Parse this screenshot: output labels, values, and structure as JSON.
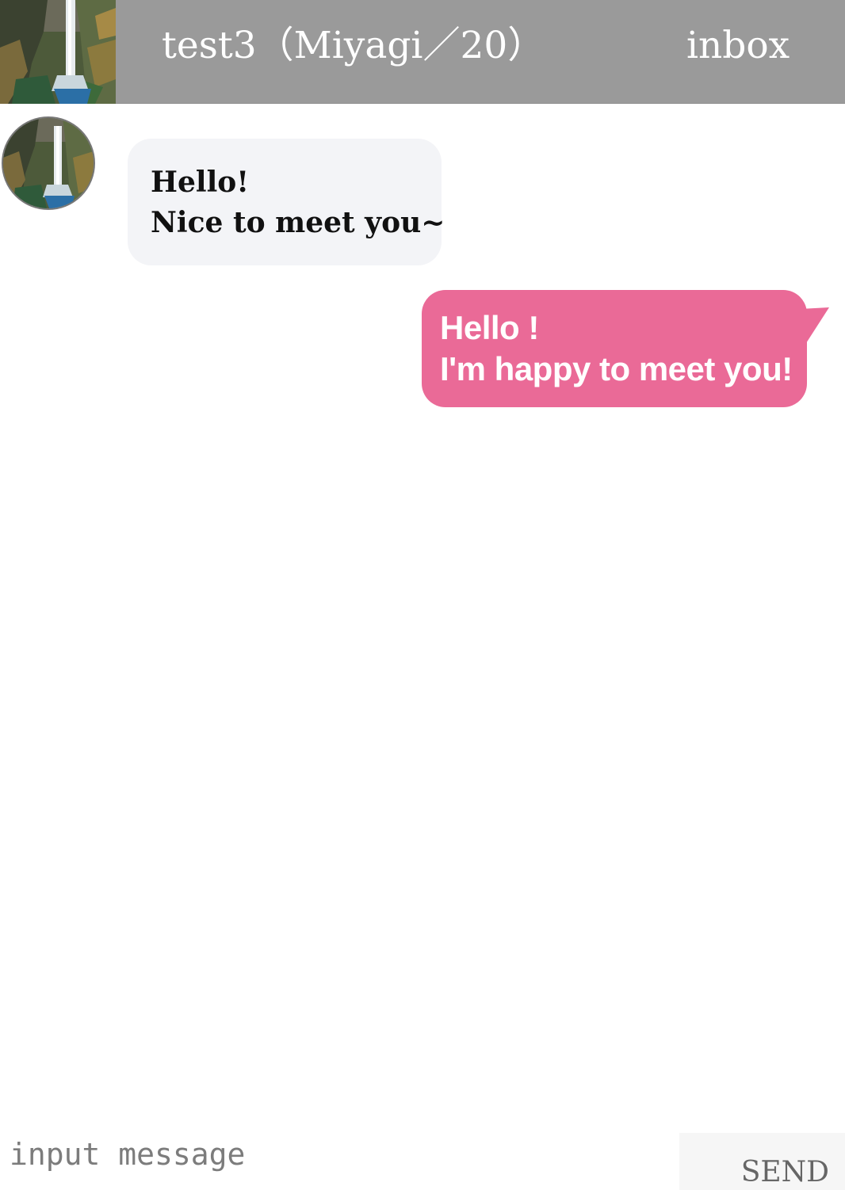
{
  "header": {
    "title": "test3（Miyagi／20）",
    "inbox_label": "inbox",
    "bar_color": "#9a9a9a"
  },
  "chat": {
    "messages": [
      {
        "direction": "incoming",
        "lines": [
          "Hello!",
          "Nice to meet you~"
        ],
        "bubble_color": "#f3f4f7"
      },
      {
        "direction": "outgoing",
        "lines": [
          "Hello !",
          "I'm happy to meet you!"
        ],
        "bubble_color": "#ea6a97"
      }
    ]
  },
  "composer": {
    "value": "",
    "placeholder": "input message",
    "send_label": "SEND"
  },
  "icons": {
    "header_thumbnail": "waterfall-photo-icon",
    "avatar": "waterfall-avatar-icon"
  }
}
